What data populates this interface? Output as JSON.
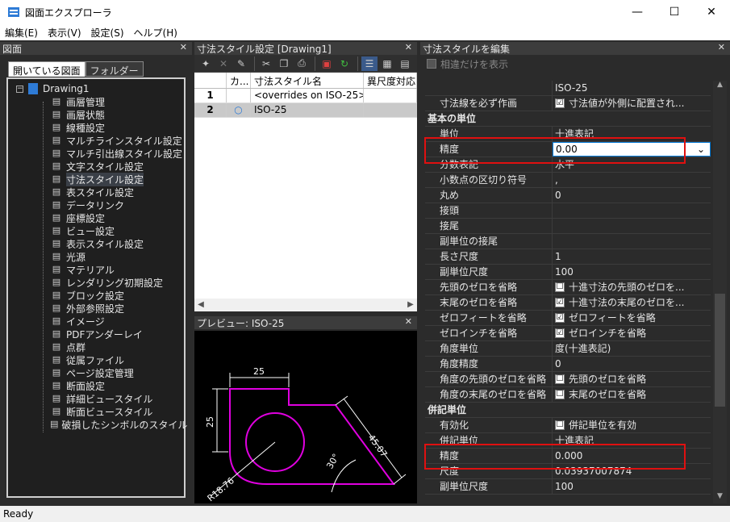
{
  "window": {
    "title": "図面エクスプローラ"
  },
  "menu": [
    "編集(E)",
    "表示(V)",
    "設定(S)",
    "ヘルプ(H)"
  ],
  "left_panel": {
    "header": "図面",
    "tabs": [
      "開いている図面",
      "フォルダー"
    ],
    "root": "Drawing1",
    "items": [
      {
        "label": "画層管理",
        "icon": "layer-manager-icon"
      },
      {
        "label": "画層状態",
        "icon": "layer-state-icon"
      },
      {
        "label": "線種設定",
        "icon": "linetype-icon"
      },
      {
        "label": "マルチラインスタイル設定",
        "icon": "mline-style-icon"
      },
      {
        "label": "マルチ引出線スタイル設定",
        "icon": "mleader-style-icon"
      },
      {
        "label": "文字スタイル設定",
        "icon": "text-style-icon"
      },
      {
        "label": "寸法スタイル設定",
        "icon": "dim-style-icon"
      },
      {
        "label": "表スタイル設定",
        "icon": "table-style-icon"
      },
      {
        "label": "データリンク",
        "icon": "datalink-icon"
      },
      {
        "label": "座標設定",
        "icon": "ucs-icon"
      },
      {
        "label": "ビュー設定",
        "icon": "view-icon"
      },
      {
        "label": "表示スタイル設定",
        "icon": "visual-style-icon"
      },
      {
        "label": "光源",
        "icon": "light-icon"
      },
      {
        "label": "マテリアル",
        "icon": "material-icon"
      },
      {
        "label": "レンダリング初期設定",
        "icon": "render-preset-icon"
      },
      {
        "label": "ブロック設定",
        "icon": "block-icon"
      },
      {
        "label": "外部参照設定",
        "icon": "xref-icon"
      },
      {
        "label": "イメージ",
        "icon": "image-icon"
      },
      {
        "label": "PDFアンダーレイ",
        "icon": "pdf-underlay-icon"
      },
      {
        "label": "点群",
        "icon": "point-cloud-icon"
      },
      {
        "label": "従属ファイル",
        "icon": "dependent-file-icon"
      },
      {
        "label": "ページ設定管理",
        "icon": "page-setup-icon"
      },
      {
        "label": "断面設定",
        "icon": "section-icon"
      },
      {
        "label": "詳細ビュースタイル",
        "icon": "detail-view-icon"
      },
      {
        "label": "断面ビュースタイル",
        "icon": "section-view-icon"
      },
      {
        "label": "破損したシンボルのスタイル",
        "icon": "broken-symbol-icon"
      }
    ],
    "selected_index": 6
  },
  "mid_panel": {
    "header": "寸法スタイル設定 [Drawing1]",
    "columns": [
      "カ...",
      "寸法スタイル名",
      "異尺度対応"
    ],
    "rows": [
      {
        "num": "1",
        "current": "",
        "name": "<overrides on ISO-25>",
        "annotative": ""
      },
      {
        "num": "2",
        "current": "○",
        "name": "ISO-25",
        "annotative": ""
      }
    ],
    "preview_header": "プレビュー: ISO-25",
    "preview_dims": {
      "top": "25",
      "left": "25",
      "slant": "45.07",
      "angle": "30°",
      "radius": "R18.76"
    }
  },
  "right_panel": {
    "header": "寸法スタイルを編集",
    "diff_only": "相違だけを表示",
    "column_head": "ISO-25",
    "rows": [
      {
        "type": "prop",
        "name": "寸法線を必ず作画",
        "check": "☑",
        "value": "寸法値が外側に配置され..."
      },
      {
        "type": "cat",
        "name": "基本の単位"
      },
      {
        "type": "prop",
        "name": "単位",
        "value": "十進表記"
      },
      {
        "type": "active",
        "name": "精度",
        "value": "0.00"
      },
      {
        "type": "prop",
        "name": "分数表記",
        "value": "水平"
      },
      {
        "type": "prop",
        "name": "小数点の区切り符号",
        "value": ","
      },
      {
        "type": "prop",
        "name": "丸め",
        "value": "0"
      },
      {
        "type": "prop",
        "name": "接頭",
        "value": ""
      },
      {
        "type": "prop",
        "name": "接尾",
        "value": ""
      },
      {
        "type": "prop",
        "name": "副単位の接尾",
        "value": ""
      },
      {
        "type": "prop",
        "name": "長さ尺度",
        "value": "1"
      },
      {
        "type": "prop",
        "name": "副単位尺度",
        "value": "100"
      },
      {
        "type": "prop",
        "name": "先頭のゼロを省略",
        "check": "☐",
        "value": "十進寸法の先頭のゼロを..."
      },
      {
        "type": "prop",
        "name": "末尾のゼロを省略",
        "check": "☑",
        "value": "十進寸法の末尾のゼロを..."
      },
      {
        "type": "prop",
        "name": "ゼロフィートを省略",
        "check": "☑",
        "value": "ゼロフィートを省略"
      },
      {
        "type": "prop",
        "name": "ゼロインチを省略",
        "check": "☑",
        "value": "ゼロインチを省略"
      },
      {
        "type": "prop",
        "name": "角度単位",
        "value": "度(十進表記)"
      },
      {
        "type": "prop",
        "name": "角度精度",
        "value": "0"
      },
      {
        "type": "prop",
        "name": "角度の先頭のゼロを省略",
        "check": "☐",
        "value": "先頭のゼロを省略"
      },
      {
        "type": "prop",
        "name": "角度の末尾のゼロを省略",
        "check": "☐",
        "value": "末尾のゼロを省略"
      },
      {
        "type": "cat",
        "name": "併記単位"
      },
      {
        "type": "prop",
        "name": "有効化",
        "check": "☐",
        "value": "併記単位を有効"
      },
      {
        "type": "prop",
        "name": "併記単位",
        "value": "十進表記"
      },
      {
        "type": "prop",
        "name": "精度",
        "value": "0.000"
      },
      {
        "type": "prop",
        "name": "尺度",
        "value": "0.03937007874"
      },
      {
        "type": "prop",
        "name": "副単位尺度",
        "value": "100"
      }
    ]
  },
  "status": "Ready",
  "colors": {
    "accent": "#0078d7",
    "highlight_box": "#e01010",
    "preview_shape": "#e000e0"
  }
}
